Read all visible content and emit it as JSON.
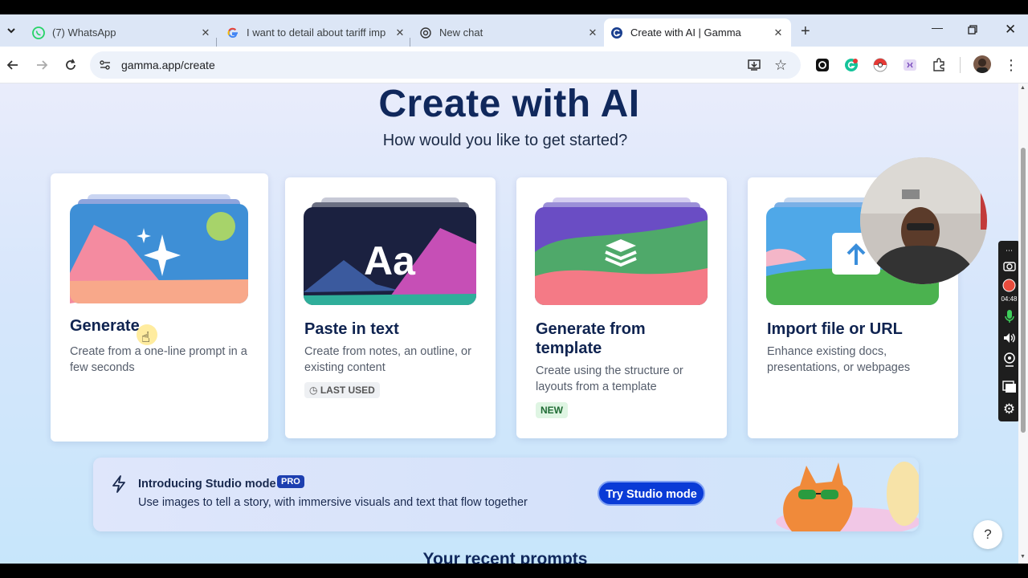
{
  "tabs": [
    {
      "title": "(7) WhatsApp",
      "favicon": "whatsapp-icon"
    },
    {
      "title": "I want to detail about tariff imp",
      "favicon": "google-icon"
    },
    {
      "title": "New chat",
      "favicon": "chatgpt-icon"
    },
    {
      "title": "Create with AI | Gamma",
      "favicon": "gamma-icon",
      "active": true
    }
  ],
  "address_bar": {
    "url": "gamma.app/create"
  },
  "page": {
    "title": "Create with AI",
    "subtitle": "How would you like to get started?",
    "cards": [
      {
        "title": "Generate",
        "description": "Create from a one-line prompt in a few seconds",
        "badge": ""
      },
      {
        "title": "Paste in text",
        "description": "Create from notes, an outline, or existing content",
        "badge": "LAST USED"
      },
      {
        "title": "Generate from template",
        "description": "Create using the structure or layouts from a template",
        "badge": "NEW"
      },
      {
        "title": "Import file or URL",
        "description": "Enhance existing docs, presentations, or webpages",
        "badge": ""
      }
    ],
    "banner": {
      "title": "Introducing Studio mode",
      "pro_badge": "PRO",
      "description": "Use images to tell a story, with immersive visuals and text that flow together",
      "button": "Try Studio mode"
    },
    "recent_heading": "Your recent prompts",
    "help_label": "?"
  },
  "recorder": {
    "time": "04:48"
  },
  "colors": {
    "brand_navy": "#10285c",
    "button_blue": "#0a3bd6",
    "new_badge_bg": "#dff5e3",
    "new_badge_fg": "#1f6b34"
  }
}
